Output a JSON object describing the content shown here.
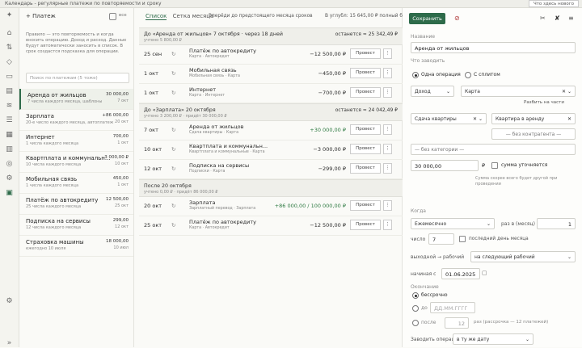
{
  "window": {
    "title": "Календарь - регулярные платежи по повторяемости и сроку",
    "top_button": "Что здесь нового"
  },
  "sidebar": {
    "add_label": "+ Платеж",
    "toggle_label": "все",
    "description": "Правило — это повторяемость и когда вносить операцию. Доход и расход. Данные будут автоматически заносить в список. В срок создастся подсказка для операции.",
    "search_placeholder": "Поиск по платежам (5 тоже)",
    "items": [
      {
        "name": "Аренда от жильцов",
        "sub": "7 числа каждого месяца, шаблоны",
        "amount": "30 000,00",
        "due": "7 окт"
      },
      {
        "name": "Зарплата",
        "sub": "20-е число каждого месяца, автоплатеж",
        "amount": "+86 000,00",
        "due": "20 окт"
      },
      {
        "name": "Интернет",
        "sub": "1 числа каждого месяца",
        "amount": "700,00",
        "due": "1 окт"
      },
      {
        "name": "Квартплата и коммунальн...",
        "sub": "10 числа каждого месяца",
        "amount": "3 000,00 ₽",
        "due": "10 окт"
      },
      {
        "name": "Мобильная связь",
        "sub": "1 числа каждого месяца",
        "amount": "450,00",
        "due": "1 окт"
      },
      {
        "name": "Платёж по автокредиту",
        "sub": "25 числа каждого месяца",
        "amount": "12 500,00",
        "due": "25 окт"
      },
      {
        "name": "Подписка на сервисы",
        "sub": "12 числа каждого месяца",
        "amount": "299,00",
        "due": "12 окт"
      },
      {
        "name": "Страховка машины",
        "sub": "ежегодно 10 июля",
        "amount": "18 000,00",
        "due": "10 июл"
      }
    ]
  },
  "main": {
    "tabs": [
      "Список",
      "Сетка месяца"
    ],
    "filter": "Вперёди до предстоящего месяца сроков",
    "balance": "В углубл: 15 645,00 ₽  полный баланс",
    "groups": [
      {
        "title": "До «Аренда от жильцов» 7 октября · через 18 дней",
        "sub": "учтено 5 800,00 ₽",
        "right": "останется ≈ 25 342,49 ₽",
        "rows": [
          {
            "date": "25 сен",
            "icon": "↻",
            "name": "Платёж по автокредиту",
            "sub": "Карта · Автокредит",
            "amount": "−12 500,00 ₽",
            "pos": false
          },
          {
            "date": "1 окт",
            "icon": "↻",
            "name": "Мобильная связь",
            "sub": "Мобильная связь · Карта",
            "amount": "−450,00 ₽",
            "pos": false
          },
          {
            "date": "1 окт",
            "icon": "↻",
            "name": "Интернет",
            "sub": "Карта · Интернет",
            "amount": "−700,00 ₽",
            "pos": false
          }
        ]
      },
      {
        "title": "До «Зарплата» 20 октября",
        "sub": "учтено 3 200,00 ₽ · придёт 30 000,00 ₽",
        "right": "останется ≈ 24 042,49 ₽",
        "rows": [
          {
            "date": "7 окт",
            "icon": "↻",
            "name": "Аренда от жильцов",
            "sub": "Сдача квартиры · Карта",
            "amount": "+30 000,00 ₽",
            "pos": true
          },
          {
            "date": "10 окт",
            "icon": "↻",
            "name": "Квартплата и коммунальн...",
            "sub": "Квартплата и коммунальные · Карта",
            "amount": "−3 000,00 ₽",
            "pos": false
          },
          {
            "date": "12 окт",
            "icon": "↻",
            "name": "Подписка на сервисы",
            "sub": "Подписки · Карта",
            "amount": "−299,00 ₽",
            "pos": false
          }
        ]
      },
      {
        "title": "После 20 октября",
        "sub": "учтено 0,00 ₽ · придёт 86 000,00 ₽",
        "right": "",
        "rows": [
          {
            "date": "20 окт",
            "icon": "↻",
            "name": "Зарплата",
            "sub": "Зарплатный перевод · Зарплата",
            "amount": "+86 000,00 / 100 000,00 ₽",
            "pos": true
          },
          {
            "date": "25 окт",
            "icon": "↻",
            "name": "Платёж по автокредиту",
            "sub": "Карта · Автокредит",
            "amount": "−12 500,00 ₽",
            "pos": false
          }
        ]
      }
    ],
    "act_label": "Провест",
    "more_label": "⋮"
  },
  "form": {
    "save": "Сохранить",
    "name_label": "Название",
    "name_value": "Аренда от жильцов",
    "what_label": "Что заводить",
    "radio1": "Одна операция",
    "radio2": "С сплитом",
    "type_value": "Доход",
    "account_value": "Карта",
    "split_link": "Разбить на части",
    "cat_value": "Сдача квартиры",
    "sub_value": "Квартира в аренду",
    "payee_placeholder": "— без контрагента —",
    "tag_placeholder": "— без категории —",
    "amount_value": "30 000,00",
    "currency": "₽",
    "amount_check": "сумма уточняется",
    "amount_hint": "Сумма скорее всего будет другой при проведении",
    "when_label": "Когда",
    "freq_value": "Ежемесячно",
    "every_label": "раз в (месяц)",
    "every_value": "1",
    "day_label": "число",
    "day_value": "7",
    "lastday_label": "последний день месяца",
    "shift_label": "выходной → рабочий",
    "shift_value": "на следующий рабочий",
    "start_label": "начиная с",
    "start_value": "01.06.2025",
    "end_label": "Окончание",
    "end_never": "бессрочно",
    "end_date": "до",
    "end_date_ph": "ДД.ММ.ГГГГ",
    "end_count": "после",
    "end_count_value": "12",
    "end_count_suffix": "раз (рассрочка — 12 платежей)",
    "remind_label": "Заводить операцию",
    "remind_value": "в ту же дату"
  }
}
